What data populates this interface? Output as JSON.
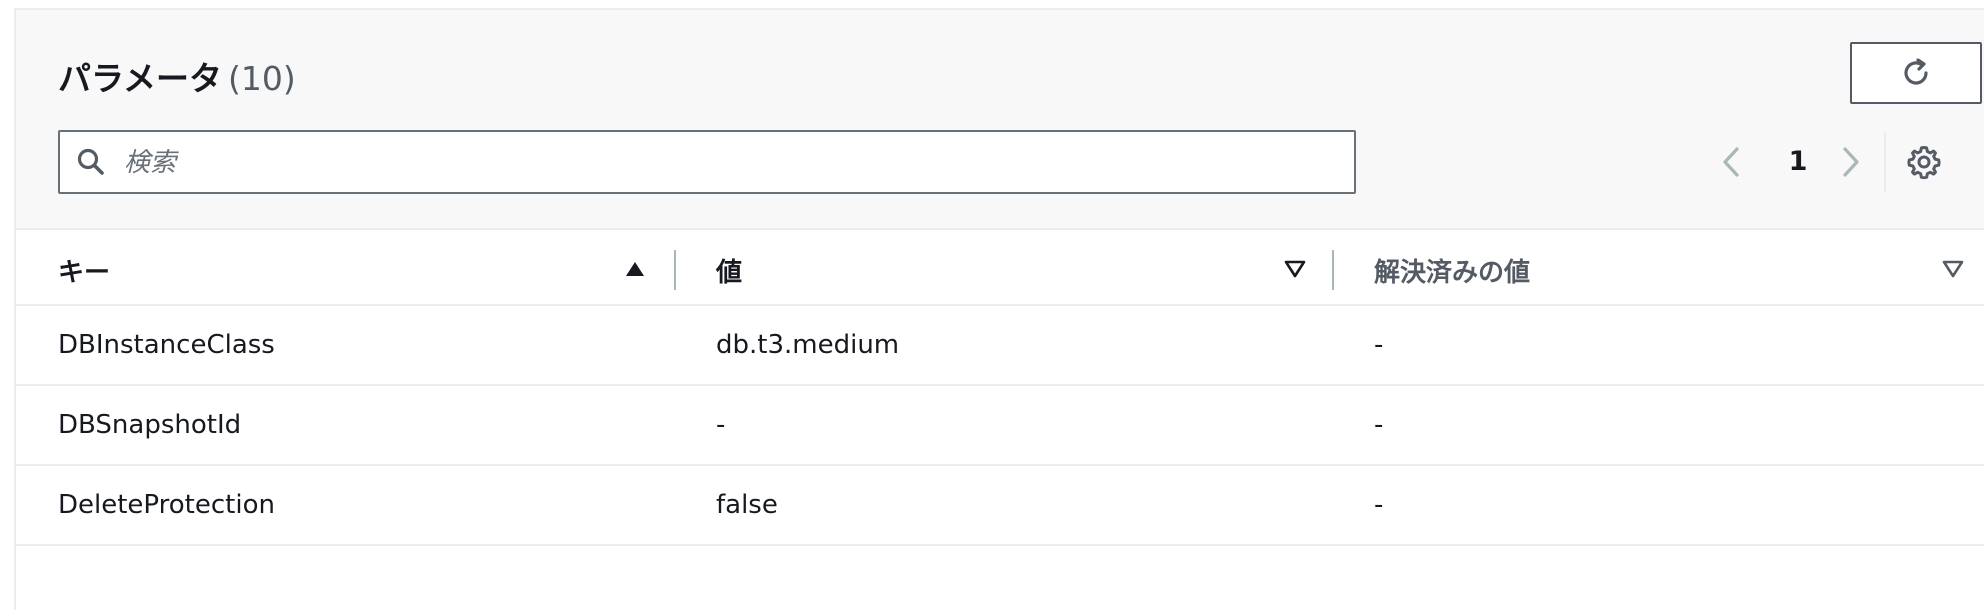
{
  "header": {
    "title": "パラメータ",
    "count": "(10)",
    "refresh_icon": "refresh-icon"
  },
  "search": {
    "placeholder": "検索",
    "value": ""
  },
  "pagination": {
    "current_page": "1",
    "prev_icon": "chevron-left-icon",
    "next_icon": "chevron-right-icon",
    "settings_icon": "gear-icon"
  },
  "table": {
    "columns": [
      {
        "label": "キー",
        "sort": "ascending"
      },
      {
        "label": "値",
        "sort": "unsorted"
      },
      {
        "label": "解決済みの値",
        "sort": "unsorted"
      }
    ],
    "rows": [
      {
        "key": "DBInstanceClass",
        "value": "db.t3.medium",
        "resolved": "-"
      },
      {
        "key": "DBSnapshotId",
        "value": "-",
        "resolved": "-"
      },
      {
        "key": "DeleteProtection",
        "value": "false",
        "resolved": "-"
      }
    ]
  },
  "colors": {
    "text": "#16191f",
    "muted": "#545b64",
    "border": "#eaeded",
    "header_bg": "#f8f8f8"
  }
}
